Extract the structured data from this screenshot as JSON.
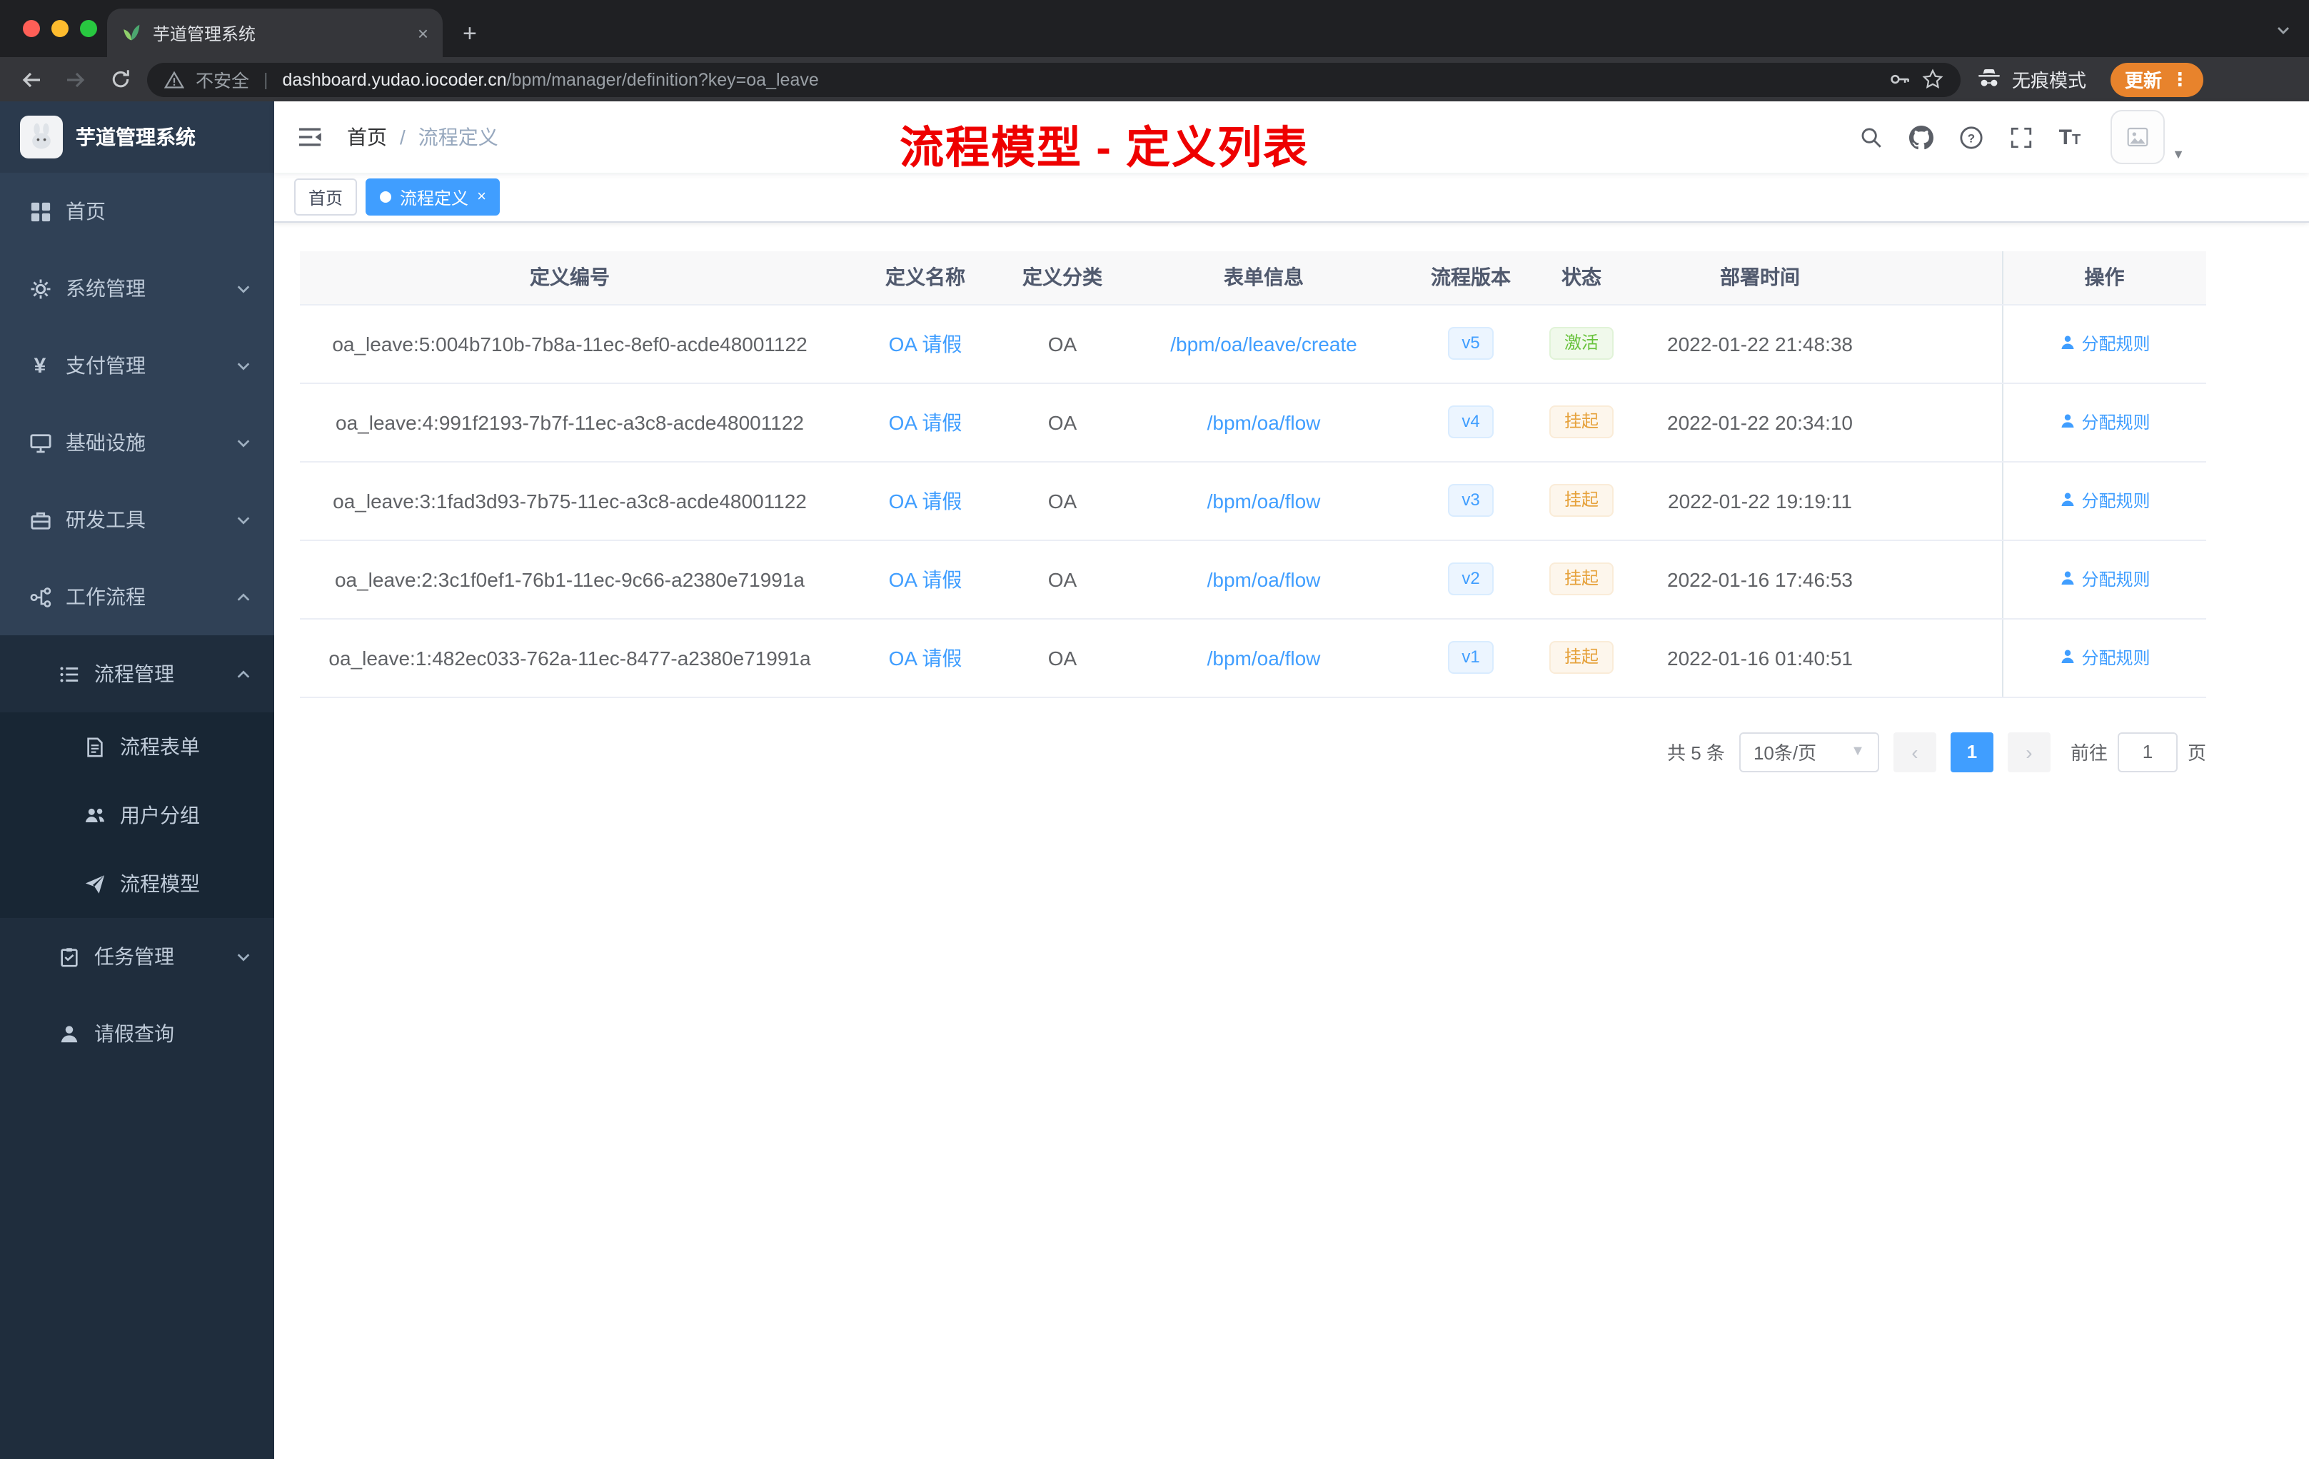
{
  "colors": {
    "accent": "#409eff",
    "success": "#67c23a",
    "warning": "#e6a23c",
    "annotation_red": "#ee0000",
    "sidebar_bg": "#304156",
    "submenu_bg": "#1f2d3d"
  },
  "browser": {
    "tab_title": "芋道管理系统",
    "new_tab_label": "+",
    "close_label": "×",
    "security_label": "不安全",
    "url_host": "dashboard.yudao.iocoder.cn",
    "url_path": "/bpm/manager/definition?key=oa_leave",
    "incognito_label": "无痕模式",
    "update_label": "更新",
    "menu_dots": "⋮"
  },
  "sidebar": {
    "logo_title": "芋道管理系统",
    "items": [
      {
        "label": "首页",
        "icon": "home-icon"
      },
      {
        "label": "系统管理",
        "icon": "gear-icon",
        "expand": "down"
      },
      {
        "label": "支付管理",
        "icon": "yen-icon",
        "expand": "down"
      },
      {
        "label": "基础设施",
        "icon": "monitor-icon",
        "expand": "down"
      },
      {
        "label": "研发工具",
        "icon": "toolbox-icon",
        "expand": "down"
      },
      {
        "label": "工作流程",
        "icon": "workflow-icon",
        "expand": "up"
      },
      {
        "label": "流程管理",
        "icon": "list-icon",
        "expand": "up"
      },
      {
        "label": "流程表单",
        "icon": "form-icon"
      },
      {
        "label": "用户分组",
        "icon": "user-group-icon"
      },
      {
        "label": "流程模型",
        "icon": "paper-plane-icon"
      },
      {
        "label": "任务管理",
        "icon": "task-icon",
        "expand": "down"
      },
      {
        "label": "请假查询",
        "icon": "user-icon"
      }
    ]
  },
  "header": {
    "breadcrumb_home": "首页",
    "breadcrumb_sep": "/",
    "breadcrumb_current": "流程定义",
    "annotation": "流程模型 - 定义列表",
    "icons": [
      "search-icon",
      "github-icon",
      "help-icon",
      "fullscreen-icon",
      "font-size-icon"
    ]
  },
  "tags": {
    "home": "首页",
    "active": "流程定义",
    "active_close": "×"
  },
  "table": {
    "columns": [
      "定义编号",
      "定义名称",
      "定义分类",
      "表单信息",
      "流程版本",
      "状态",
      "部署时间",
      "操作"
    ],
    "rows": [
      {
        "id": "oa_leave:5:004b710b-7b8a-11ec-8ef0-acde48001122",
        "name": "OA 请假",
        "category": "OA",
        "form": "/bpm/oa/leave/create",
        "version": "v5",
        "status": "激活",
        "time": "2022-01-22 21:48:38",
        "action": "分配规则"
      },
      {
        "id": "oa_leave:4:991f2193-7b7f-11ec-a3c8-acde48001122",
        "name": "OA 请假",
        "category": "OA",
        "form": "/bpm/oa/flow",
        "version": "v4",
        "status": "挂起",
        "time": "2022-01-22 20:34:10",
        "action": "分配规则"
      },
      {
        "id": "oa_leave:3:1fad3d93-7b75-11ec-a3c8-acde48001122",
        "name": "OA 请假",
        "category": "OA",
        "form": "/bpm/oa/flow",
        "version": "v3",
        "status": "挂起",
        "time": "2022-01-22 19:19:11",
        "action": "分配规则"
      },
      {
        "id": "oa_leave:2:3c1f0ef1-76b1-11ec-9c66-a2380e71991a",
        "name": "OA 请假",
        "category": "OA",
        "form": "/bpm/oa/flow",
        "version": "v2",
        "status": "挂起",
        "time": "2022-01-16 17:46:53",
        "action": "分配规则"
      },
      {
        "id": "oa_leave:1:482ec033-762a-11ec-8477-a2380e71991a",
        "name": "OA 请假",
        "category": "OA",
        "form": "/bpm/oa/flow",
        "version": "v1",
        "status": "挂起",
        "time": "2022-01-16 01:40:51",
        "action": "分配规则"
      }
    ]
  },
  "pagination": {
    "total": "共 5 条",
    "page_size": "10条/页",
    "prev": "‹",
    "next": "›",
    "current_page": "1",
    "goto_label": "前往",
    "goto_value": "1",
    "goto_unit": "页"
  }
}
